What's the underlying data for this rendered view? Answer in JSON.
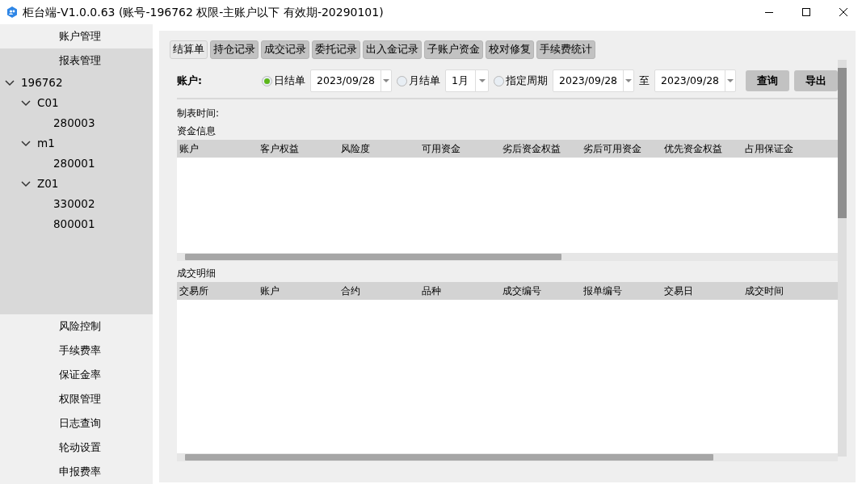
{
  "window": {
    "title": "柜台端-V1.0.0.63 (账号-196762 权限-主账户以下 有效期-20290101)"
  },
  "sidebar": {
    "top_items": [
      {
        "label": "账户管理",
        "selected": false
      },
      {
        "label": "报表管理",
        "selected": true
      }
    ],
    "tree": [
      {
        "label": "196762",
        "expanded": true,
        "children": [
          {
            "label": "C01",
            "expanded": true,
            "children": [
              {
                "label": "280003"
              }
            ]
          },
          {
            "label": "m1",
            "expanded": true,
            "children": [
              {
                "label": "280001"
              }
            ]
          },
          {
            "label": "Z01",
            "expanded": true,
            "children": [
              {
                "label": "330002"
              },
              {
                "label": "800001"
              }
            ]
          }
        ]
      }
    ],
    "bottom_items": [
      {
        "label": "风险控制",
        "selected": false
      },
      {
        "label": "手续费率",
        "selected": false
      },
      {
        "label": "保证金率",
        "selected": false
      },
      {
        "label": "权限管理",
        "selected": false
      },
      {
        "label": "日志查询",
        "selected": false
      },
      {
        "label": "轮动设置",
        "selected": false
      },
      {
        "label": "申报费率",
        "selected": false
      }
    ]
  },
  "tabs": [
    {
      "label": "结算单",
      "selected": true
    },
    {
      "label": "持仓记录",
      "selected": false
    },
    {
      "label": "成交记录",
      "selected": false
    },
    {
      "label": "委托记录",
      "selected": false
    },
    {
      "label": "出入金记录",
      "selected": false
    },
    {
      "label": "子账户资金",
      "selected": false
    },
    {
      "label": "校对修复",
      "selected": false
    },
    {
      "label": "手续费统计",
      "selected": false
    }
  ],
  "filter": {
    "account_label": "账户:",
    "period_options": [
      {
        "label": "日结单",
        "selected": true,
        "value": "2023/09/28",
        "kind": "date"
      },
      {
        "label": "月结单",
        "selected": false,
        "value": "1月",
        "kind": "month"
      },
      {
        "label": "指定周期",
        "selected": false,
        "value": "2023/09/28",
        "kind": "date"
      }
    ],
    "range_separator": "至",
    "range_end": "2023/09/28",
    "buttons": [
      "查询",
      "导出"
    ]
  },
  "report_time_label": "制表时间:",
  "sections": [
    {
      "title": "资金信息",
      "columns": [
        "账户",
        "客户权益",
        "风险度",
        "可用资金",
        "劣后资金权益",
        "劣后可用资金",
        "优先资金权益",
        "占用保证金"
      ]
    },
    {
      "title": "成交明细",
      "columns": [
        "交易所",
        "账户",
        "合约",
        "品种",
        "成交编号",
        "报单编号",
        "交易日",
        "成交时间"
      ]
    }
  ]
}
